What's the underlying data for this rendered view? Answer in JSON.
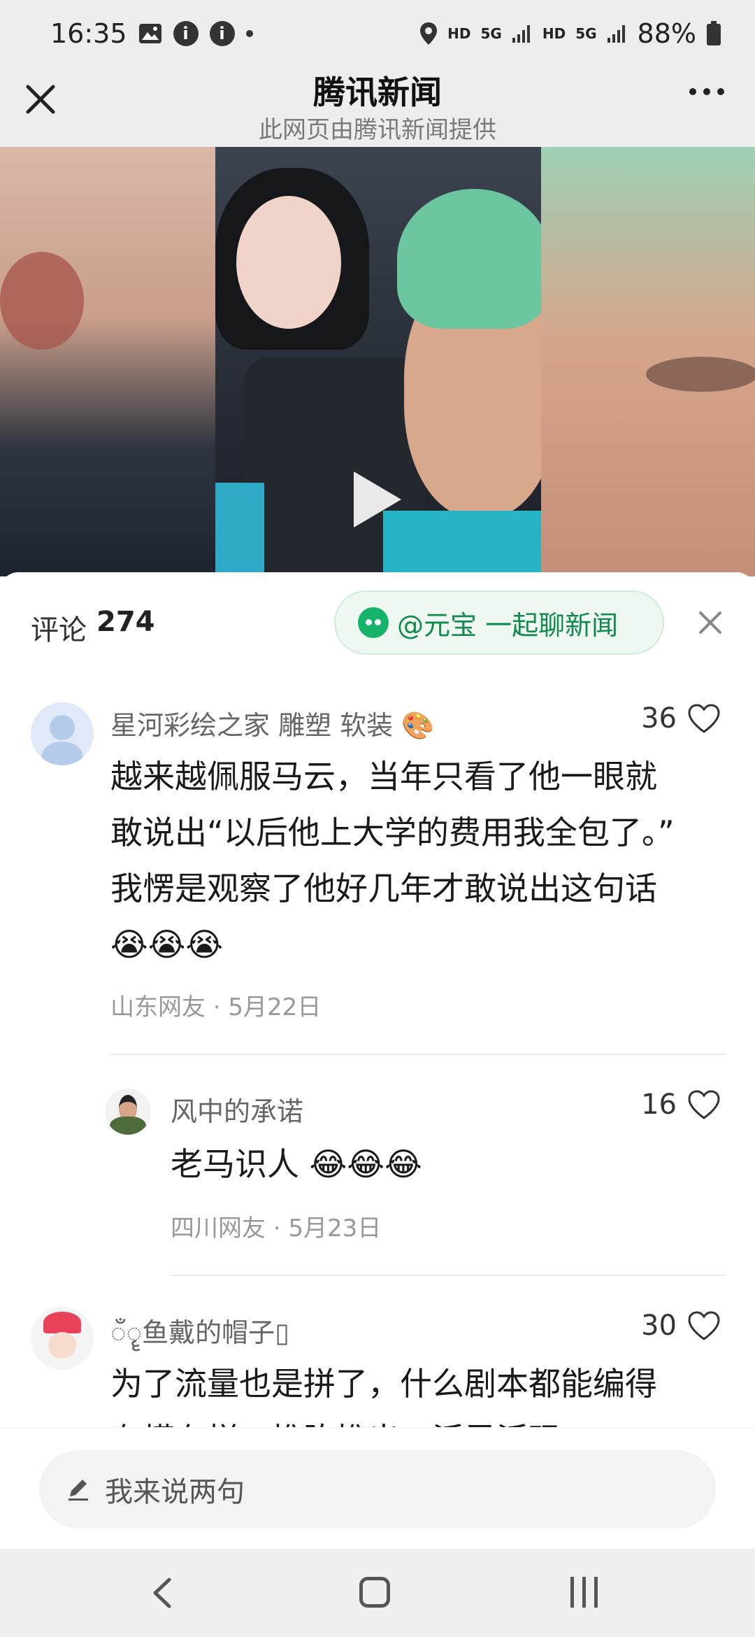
{
  "status_bar": {
    "time": "16:35",
    "battery": "88%",
    "net1": "HD",
    "net2": "5G",
    "net3": "HD",
    "net4": "5G",
    "icons": [
      "image-icon",
      "info-icon",
      "info-icon",
      "dot-icon",
      "location-icon",
      "signal-icon",
      "battery-icon"
    ]
  },
  "header": {
    "title": "腾讯新闻",
    "subtitle": "此网页由腾讯新闻提供"
  },
  "panel": {
    "count_label": "评论",
    "count": "274",
    "yuanbao_label": "@元宝 一起聊新闻"
  },
  "comments": [
    {
      "name": "星河彩绘之家 雕塑 软装",
      "name_emoji": "🎨",
      "likes": "36",
      "body": "越来越佩服马云，当年只看了他一眼就敢说出“以后他上大学的费用我全包了。” 我愣是观察了他好几年才敢说出这句话",
      "body_emoji": "😭😭😭",
      "meta": "山东网友 · 5月22日"
    },
    {
      "name": "风中的承诺",
      "likes": "16",
      "body": "老马识人",
      "body_emoji": "😂😂😂",
      "meta": "四川网友 · 5月23日"
    },
    {
      "name_prefix": "ँॄ",
      "name": "鱼戴的帽子",
      "name_suffix": "▯",
      "likes": "30",
      "body": "为了流量也是拼了，什么剧本都能编得有模有样，推陈推出，活灵活现"
    }
  ],
  "input": {
    "placeholder": "我来说两句"
  },
  "colors": {
    "accent_green": "#128a4f",
    "header_bg": "#ededed"
  }
}
